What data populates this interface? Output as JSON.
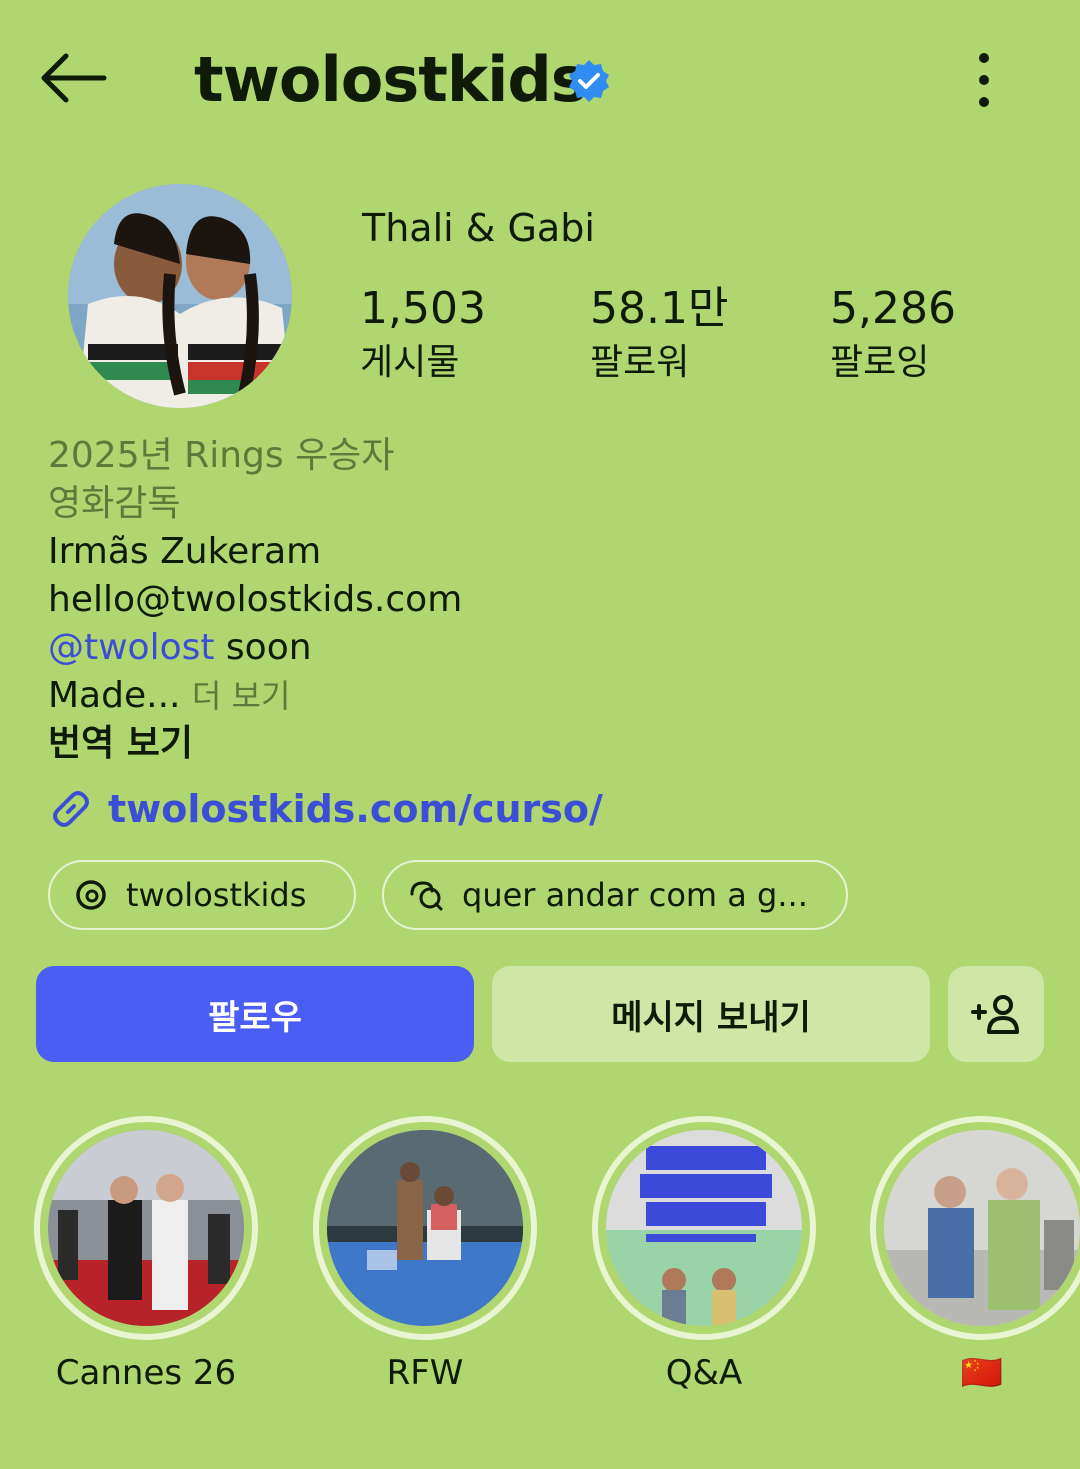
{
  "header": {
    "username": "twolostkids",
    "back_icon": "arrow-left-icon",
    "verified_icon": "verified-badge-icon",
    "more_icon": "more-vertical-icon"
  },
  "profile": {
    "display_name": "Thali & Gabi",
    "stats": [
      {
        "value": "1,503",
        "label": "게시물"
      },
      {
        "value": "58.1만",
        "label": "팔로워"
      },
      {
        "value": "5,286",
        "label": "팔로잉"
      }
    ]
  },
  "bio": {
    "award": "2025년 Rings 우승자",
    "category": "영화감독",
    "line1": "Irmãs Zukeram",
    "line2": "hello@twolostkids.com",
    "mention_at": "@",
    "mention": "twolost",
    "mention_suffix": " soon",
    "truncated": "Made...",
    "more": "더 보기",
    "translate": "번역 보기",
    "website": "twolostkids.com/curso/"
  },
  "chips": [
    {
      "label": "twolostkids",
      "icon": "threads-icon"
    },
    {
      "label": "quer andar com a g...",
      "icon": "chat-bubbles-icon"
    }
  ],
  "actions": {
    "follow": "팔로우",
    "message": "메시지 보내기",
    "add_user_icon": "add-person-icon"
  },
  "highlights": [
    {
      "label": "Cannes 26"
    },
    {
      "label": "RFW"
    },
    {
      "label": "Q&A"
    },
    {
      "label": "🇨🇳"
    }
  ],
  "colors": {
    "background": "#b0d66f",
    "accent_blue": "#4a5ef5",
    "link_blue": "#3a4fd6",
    "verified_blue": "#2f8cf0"
  }
}
